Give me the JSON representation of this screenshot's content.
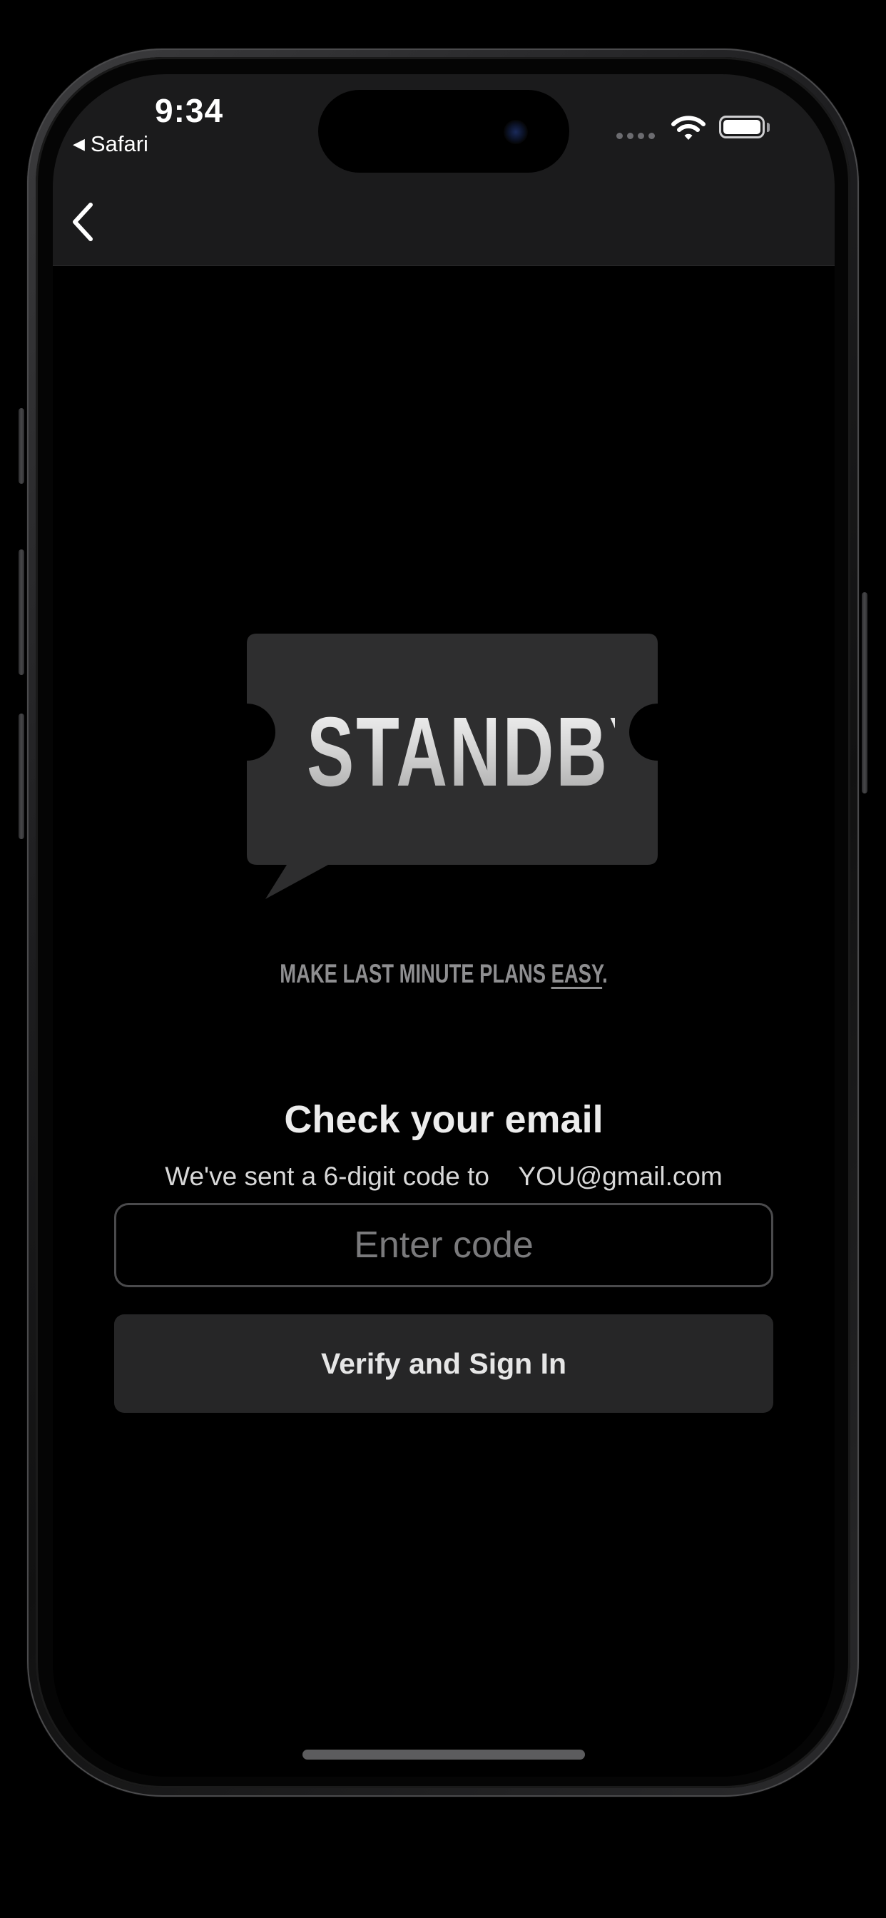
{
  "status_bar": {
    "time": "9:34",
    "back_app_label": "Safari",
    "back_app_icon": "back-triangle-icon",
    "battery_level": 1.0
  },
  "nav": {
    "back_icon": "chevron-left-icon"
  },
  "logo": {
    "text": "STANDBY",
    "bubble_color": "#2e2e2f"
  },
  "tagline": {
    "prefix": "MAKE LAST MINUTE PLANS ",
    "emphasis": "EASY",
    "suffix": "."
  },
  "verify": {
    "title": "Check your email",
    "subtitle_prefix": "We've sent a 6-digit code to",
    "email": "YOU@gmail.com",
    "code_placeholder": "Enter code",
    "code_value": "",
    "button_label": "Verify and Sign In"
  },
  "colors": {
    "background": "#000000",
    "nav_bar": "#1b1b1c",
    "button": "#262627"
  }
}
